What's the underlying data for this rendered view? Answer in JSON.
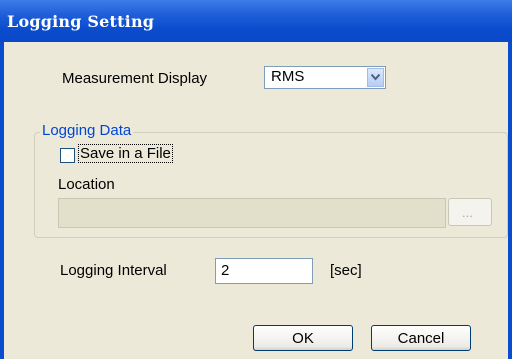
{
  "window": {
    "title": "Logging Setting"
  },
  "measurement": {
    "label": "Measurement Display",
    "selected": "RMS"
  },
  "logging_data": {
    "group_title": "Logging Data",
    "save_label": "Save in a File",
    "save_checked": false,
    "location_label": "Location",
    "location_value": "",
    "browse_label": "..."
  },
  "interval": {
    "label": "Logging Interval",
    "value": "2",
    "unit": "[sec]"
  },
  "buttons": {
    "ok": "OK",
    "cancel": "Cancel"
  }
}
